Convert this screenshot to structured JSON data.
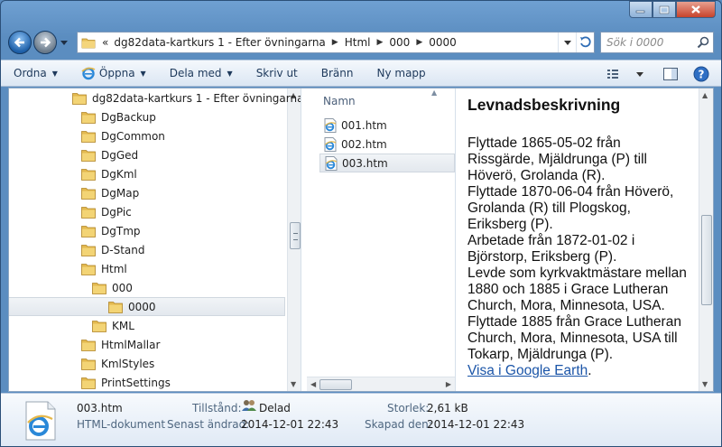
{
  "address": {
    "overflow": "«",
    "crumbs": [
      "dg82data-kartkurs 1 - Efter övningarna",
      "Html",
      "000",
      "0000"
    ]
  },
  "search": {
    "placeholder": "Sök i 0000"
  },
  "toolbar": {
    "organize": "Ordna",
    "open": "Öppna",
    "share": "Dela med",
    "print": "Skriv ut",
    "burn": "Bränn",
    "new_folder": "Ny mapp"
  },
  "tree": {
    "items": [
      {
        "label": "dg82data-kartkurs 1 - Efter övningarna",
        "level": 0
      },
      {
        "label": "DgBackup",
        "level": 1
      },
      {
        "label": "DgCommon",
        "level": 1
      },
      {
        "label": "DgGed",
        "level": 1
      },
      {
        "label": "DgKml",
        "level": 1
      },
      {
        "label": "DgMap",
        "level": 1
      },
      {
        "label": "DgPic",
        "level": 1
      },
      {
        "label": "DgTmp",
        "level": 1
      },
      {
        "label": "D-Stand",
        "level": 1
      },
      {
        "label": "Html",
        "level": 1
      },
      {
        "label": "000",
        "level": 2
      },
      {
        "label": "0000",
        "level": 3,
        "selected": true
      },
      {
        "label": "KML",
        "level": 2
      },
      {
        "label": "HtmlMallar",
        "level": 1
      },
      {
        "label": "KmlStyles",
        "level": 1
      },
      {
        "label": "PrintSettings",
        "level": 1
      }
    ]
  },
  "files": {
    "header": "Namn",
    "items": [
      {
        "name": "001.htm"
      },
      {
        "name": "002.htm"
      },
      {
        "name": "003.htm",
        "selected": true
      }
    ]
  },
  "preview": {
    "title": "Levnadsbeskrivning",
    "lines": [
      "Flyttade 1865-05-02 från",
      "Rissgärde, Mjäldrunga (P) till",
      "Höverö, Grolanda (R).",
      "Flyttade 1870-06-04 från Höverö,",
      "Grolanda (R) till Plogskog,",
      "Eriksberg (P).",
      "Arbetade från 1872-01-02 i",
      "Björstorp, Eriksberg (P).",
      "Levde som kyrkvaktmästare mellan",
      "1880 och 1885 i Grace Lutheran",
      "Church, Mora, Minnesota, USA.",
      "Flyttade 1885 från Grace Lutheran",
      "Church, Mora, Minnesota, USA till",
      "Tokarp, Mjäldrunga (P)."
    ],
    "link": "Visa i Google Earth",
    "link_suffix": "."
  },
  "details": {
    "filename": "003.htm",
    "filetype": "HTML-dokument",
    "state_label": "Tillstånd:",
    "state_value": "Delad",
    "modified_label": "Senast ändrad:",
    "modified_value": "2014-12-01 22:43",
    "size_label": "Storlek:",
    "size_value": "2,61 kB",
    "created_label": "Skapad den:",
    "created_value": "2014-12-01 22:43"
  },
  "colors": {
    "accent": "#1b55a8",
    "selection": "#e3e8ee",
    "toolbar": "#dbe6f3"
  }
}
